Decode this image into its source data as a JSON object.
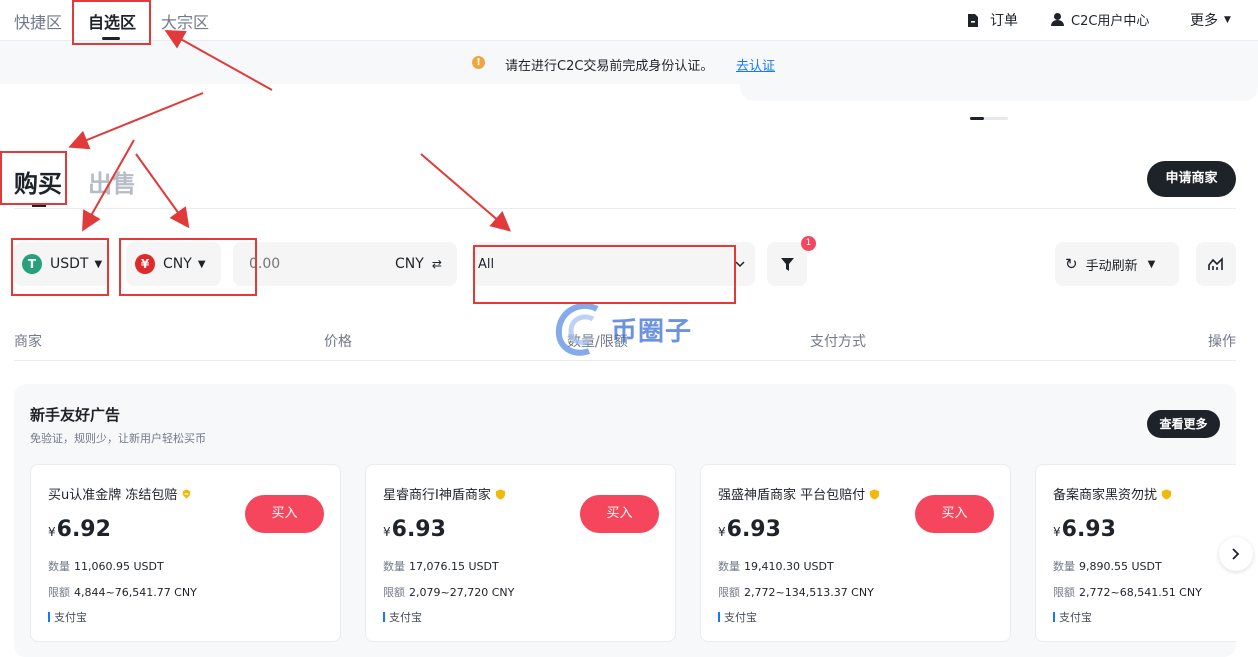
{
  "topnav": {
    "tabs": [
      "快捷区",
      "自选区",
      "大宗区"
    ],
    "orders": "订单",
    "user_center": "C2C用户中心",
    "more": "更多"
  },
  "banner": {
    "text": "请在进行C2C交易前完成身份认证。",
    "link": "去认证"
  },
  "trade": {
    "buy": "购买",
    "sell": "出售",
    "apply_merchant": "申请商家"
  },
  "filters": {
    "crypto": "USDT",
    "fiat": "CNY",
    "amount_placeholder": "0.00",
    "amount_unit": "CNY",
    "payment": "All",
    "filter_count": "1",
    "refresh": "手动刷新"
  },
  "columns": [
    "商家",
    "价格",
    "数量/限额",
    "支付方式",
    "操作"
  ],
  "watermark": "币圈子",
  "newbie": {
    "title": "新手友好广告",
    "subtitle": "免验证，规则少，让新用户轻松买币",
    "more": "查看更多",
    "qty_label": "数量",
    "limit_label": "限额",
    "buy_label": "买入",
    "currency_symbol": "¥",
    "cards": [
      {
        "name": "买u认准金牌 冻结包赔",
        "price": "6.92",
        "qty": "11,060.95 USDT",
        "limit": "4,844~76,541.77 CNY",
        "payment": "支付宝"
      },
      {
        "name": "星睿商行I神盾商家",
        "price": "6.93",
        "qty": "17,076.15 USDT",
        "limit": "2,079~27,720 CNY",
        "payment": "支付宝"
      },
      {
        "name": "强盛神盾商家 平台包赔付",
        "price": "6.93",
        "qty": "19,410.30 USDT",
        "limit": "2,772~134,513.37 CNY",
        "payment": "支付宝"
      },
      {
        "name": "备案商家黑资勿扰",
        "price": "6.93",
        "qty": "9,890.55 USDT",
        "limit": "2,772~68,541.51 CNY",
        "payment": "支付宝"
      }
    ]
  },
  "colors": {
    "accent_dark": "#1e2329",
    "buy_red": "#f6465d",
    "annotation_red": "#e03a3a",
    "tether_green": "#26a17b",
    "link_blue": "#1677ff"
  },
  "icons": [
    "order-icon",
    "user-icon",
    "caret-down-icon",
    "warning-icon",
    "tether-icon",
    "yuan-icon",
    "swap-icon",
    "chevron-down-icon",
    "filter-icon",
    "refresh-icon",
    "chart-icon",
    "badge-icon",
    "chevron-right-icon"
  ]
}
